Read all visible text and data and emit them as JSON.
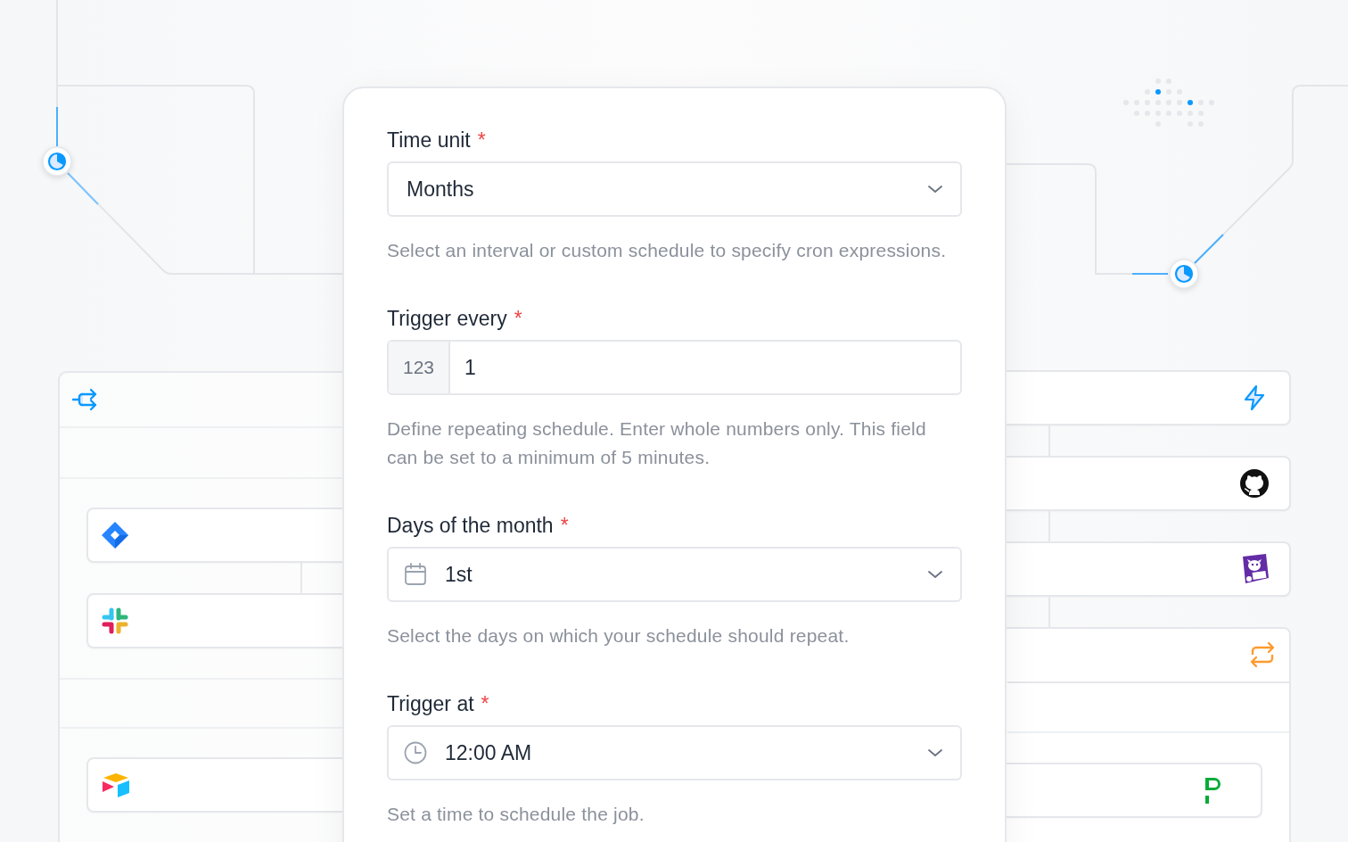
{
  "form": {
    "fields": [
      {
        "kind": "select",
        "label": "Time unit",
        "required_mark": "*",
        "value": "Months",
        "helper": "Select an interval or custom schedule to specify cron expressions."
      },
      {
        "kind": "number",
        "label": "Trigger every",
        "required_mark": "*",
        "addon": "123",
        "value": "1",
        "helper": "Define repeating schedule. Enter whole numbers only. This field can be set to a minimum of 5 minutes."
      },
      {
        "kind": "date-select",
        "label": "Days of the month",
        "required_mark": "*",
        "value": "1st",
        "helper": "Select the days on which your schedule should repeat."
      },
      {
        "kind": "time-select",
        "label": "Trigger at",
        "required_mark": "*",
        "value": "12:00 AM",
        "helper": "Set a time to schedule the job."
      }
    ]
  }
}
